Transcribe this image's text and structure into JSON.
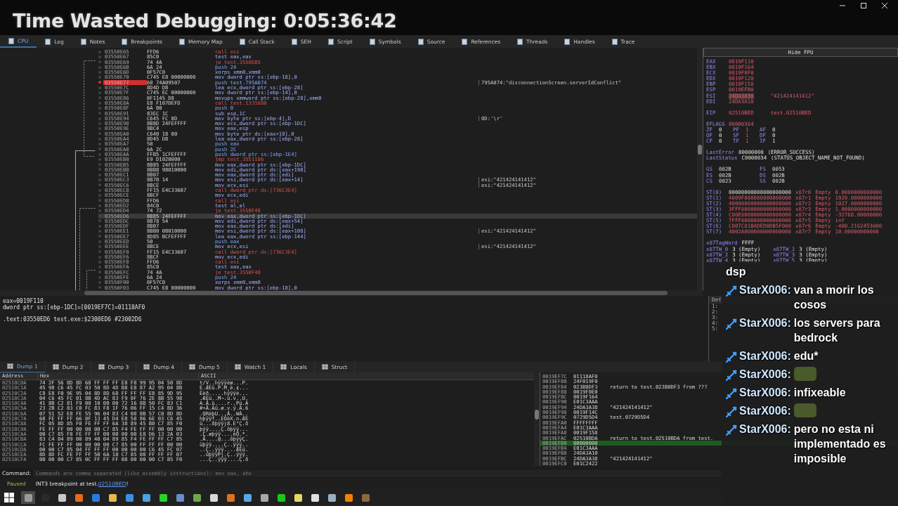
{
  "overlay_title": "Time Wasted Debugging: 0:05:36:42",
  "tabs": [
    {
      "label": "CPU",
      "selected": true
    },
    {
      "label": "Log",
      "selected": false
    },
    {
      "label": "Notes",
      "selected": false
    },
    {
      "label": "Breakpoints",
      "selected": false
    },
    {
      "label": "Memory Map",
      "selected": false
    },
    {
      "label": "Call Stack",
      "selected": false
    },
    {
      "label": "SEH",
      "selected": false
    },
    {
      "label": "Script",
      "selected": false
    },
    {
      "label": "Symbols",
      "selected": false
    },
    {
      "label": "Source",
      "selected": false
    },
    {
      "label": "References",
      "selected": false
    },
    {
      "label": "Threads",
      "selected": false
    },
    {
      "label": "Handles",
      "selected": false
    },
    {
      "label": "Trace",
      "selected": false
    }
  ],
  "disassembly": [
    {
      "address": "03550E65",
      "bytes": "FFD6",
      "instruction": "call esi",
      "kind": "call",
      "breakpoint": false,
      "selected": false
    },
    {
      "address": "03550E67",
      "bytes": "85C0",
      "instruction": "test eax,eax",
      "kind": "op",
      "breakpoint": false,
      "selected": false
    },
    {
      "address": "03550E69",
      "bytes": "74 4A",
      "instruction": "je test.3550EB5",
      "kind": "jump",
      "breakpoint": false,
      "selected": false
    },
    {
      "address": "03550E6B",
      "bytes": "6A 24",
      "instruction": "push 24",
      "kind": "push",
      "breakpoint": false,
      "selected": false
    },
    {
      "address": "03550E6D",
      "bytes": "0F57C0",
      "instruction": "xorps xmm0,xmm0",
      "kind": "op",
      "breakpoint": false,
      "selected": false
    },
    {
      "address": "03550E70",
      "bytes": "C745 E8 00000000",
      "instruction": "mov dword ptr ss:[ebp-18],0",
      "kind": "op",
      "breakpoint": false,
      "selected": false
    },
    {
      "address": "03550E77",
      "bytes": "68 74A09507",
      "instruction": "push test.795A074",
      "kind": "push",
      "breakpoint": true,
      "selected": false,
      "comment": "795A074:\"disconnectionScreen.serverIdConflict\""
    },
    {
      "address": "03550E7C",
      "bytes": "8D4D D8",
      "instruction": "lea ecx,dword ptr ss:[ebp-28]",
      "kind": "op",
      "breakpoint": false,
      "selected": false
    },
    {
      "address": "03550E7F",
      "bytes": "C745 EC 00000000",
      "instruction": "mov dword ptr ss:[ebp-14],0",
      "kind": "op",
      "breakpoint": false,
      "selected": false
    },
    {
      "address": "03550E86",
      "bytes": "0F1145 D8",
      "instruction": "movups xmmword ptr ss:[ebp-28],xmm0",
      "kind": "op",
      "breakpoint": false,
      "selected": false
    },
    {
      "address": "03550E8A",
      "bytes": "E8 F107DEFD",
      "instruction": "call test.1331680",
      "kind": "call",
      "breakpoint": false,
      "selected": false
    },
    {
      "address": "03550E8F",
      "bytes": "6A 00",
      "instruction": "push 0",
      "kind": "push",
      "breakpoint": false,
      "selected": false
    },
    {
      "address": "03550E91",
      "bytes": "83EC 1C",
      "instruction": "sub esp,1C",
      "kind": "op",
      "breakpoint": false,
      "selected": false
    },
    {
      "address": "03550E94",
      "bytes": "C645 FC 0D",
      "instruction": "mov byte ptr ss:[ebp-4],D",
      "kind": "op",
      "breakpoint": false,
      "selected": false,
      "comment": "0D:'\\r'"
    },
    {
      "address": "03550E98",
      "bytes": "8B8D 24FEFFFF",
      "instruction": "mov ecx,dword ptr ss:[ebp-1DC]",
      "kind": "op",
      "breakpoint": false,
      "selected": false
    },
    {
      "address": "03550E9E",
      "bytes": "8BC4",
      "instruction": "mov eax,esp",
      "kind": "op",
      "breakpoint": false,
      "selected": false
    },
    {
      "address": "03550EA0",
      "bytes": "C640 18 00",
      "instruction": "mov byte ptr ds:[eax+18],0",
      "kind": "op",
      "breakpoint": false,
      "selected": false
    },
    {
      "address": "03550EA4",
      "bytes": "8D45 D8",
      "instruction": "lea eax,dword ptr ss:[ebp-28]",
      "kind": "op",
      "breakpoint": false,
      "selected": false
    },
    {
      "address": "03550EA7",
      "bytes": "50",
      "instruction": "push eax",
      "kind": "push",
      "breakpoint": false,
      "selected": false
    },
    {
      "address": "03550EA8",
      "bytes": "6A 2C",
      "instruction": "push 2C",
      "kind": "push",
      "breakpoint": false,
      "selected": false
    },
    {
      "address": "03550EAA",
      "bytes": "FFB5 1CFEFFFF",
      "instruction": "push dword ptr ss:[ebp-1E4]",
      "kind": "push",
      "breakpoint": false,
      "selected": false
    },
    {
      "address": "03550EB0",
      "bytes": "E9 D1020000",
      "instruction": "jmp test.3551186",
      "kind": "jump",
      "breakpoint": false,
      "selected": false
    },
    {
      "address": "03550EB5",
      "bytes": "8B85 24FEFFFF",
      "instruction": "mov eax,dword ptr ss:[ebp-1DC]",
      "kind": "op",
      "breakpoint": false,
      "selected": false
    },
    {
      "address": "03550EBB",
      "bytes": "8BB8 98010000",
      "instruction": "mov edi,dword ptr ds:[eax+198]",
      "kind": "op",
      "breakpoint": false,
      "selected": false
    },
    {
      "address": "03550EC1",
      "bytes": "8B07",
      "instruction": "mov eax,dword ptr ds:[edi]",
      "kind": "op",
      "breakpoint": false,
      "selected": false
    },
    {
      "address": "03550EC3",
      "bytes": "8B70 14",
      "instruction": "mov esi,dword ptr ds:[eax+14]",
      "kind": "op",
      "breakpoint": false,
      "selected": false,
      "comment": "esi:\"421424141412\""
    },
    {
      "address": "03550EC6",
      "bytes": "8BCE",
      "instruction": "mov ecx,esi",
      "kind": "op",
      "breakpoint": false,
      "selected": false,
      "comment": "esi:\"421424141412\""
    },
    {
      "address": "03550EC8",
      "bytes": "FF15 E4C33607",
      "instruction": "call dword ptr ds:[736C3E4]",
      "kind": "call",
      "breakpoint": false,
      "selected": false
    },
    {
      "address": "03550ECE",
      "bytes": "8BCF",
      "instruction": "mov ecx,edi",
      "kind": "op",
      "breakpoint": false,
      "selected": false
    },
    {
      "address": "03550ED0",
      "bytes": "FFD6",
      "instruction": "call esi",
      "kind": "call",
      "breakpoint": false,
      "selected": false
    },
    {
      "address": "03550ED2",
      "bytes": "84C0",
      "instruction": "test al,al",
      "kind": "op",
      "breakpoint": false,
      "selected": false
    },
    {
      "address": "03550ED4",
      "bytes": "74 72",
      "instruction": "je test.3550F48",
      "kind": "jump",
      "breakpoint": false,
      "selected": false
    },
    {
      "address": "03550ED6",
      "bytes": "8B85 24FEFFFF",
      "instruction": "mov eax,dword ptr ss:[ebp-1DC]",
      "kind": "op",
      "breakpoint": false,
      "selected": true
    },
    {
      "address": "03550EDC",
      "bytes": "8B78 54",
      "instruction": "mov edi,dword ptr ds:[eax+54]",
      "kind": "op",
      "breakpoint": false,
      "selected": false
    },
    {
      "address": "03550EDF",
      "bytes": "8B07",
      "instruction": "mov eax,dword ptr ds:[edi]",
      "kind": "op",
      "breakpoint": false,
      "selected": false
    },
    {
      "address": "03550EE1",
      "bytes": "8BB0 08010000",
      "instruction": "mov esi,dword ptr ds:[eax+108]",
      "kind": "op",
      "breakpoint": false,
      "selected": false,
      "comment": "esi:\"421424141412\""
    },
    {
      "address": "03550EE7",
      "bytes": "8D85 BCFEFFFF",
      "instruction": "lea eax,dword ptr ss:[ebp-144]",
      "kind": "op",
      "breakpoint": false,
      "selected": false
    },
    {
      "address": "03550EED",
      "bytes": "50",
      "instruction": "push eax",
      "kind": "push",
      "breakpoint": false,
      "selected": false
    },
    {
      "address": "03550EEE",
      "bytes": "8BCE",
      "instruction": "mov ecx,esi",
      "kind": "op",
      "breakpoint": false,
      "selected": false,
      "comment": "esi:\"421424141412\""
    },
    {
      "address": "03550EF0",
      "bytes": "FF15 E4C33607",
      "instruction": "call dword ptr ds:[736C3E4]",
      "kind": "call",
      "breakpoint": false,
      "selected": false
    },
    {
      "address": "03550EF6",
      "bytes": "8BCF",
      "instruction": "mov ecx,edi",
      "kind": "op",
      "breakpoint": false,
      "selected": false
    },
    {
      "address": "03550EF8",
      "bytes": "FFD6",
      "instruction": "call esi",
      "kind": "call",
      "breakpoint": false,
      "selected": false
    },
    {
      "address": "03550EFA",
      "bytes": "85C0",
      "instruction": "test eax,eax",
      "kind": "op",
      "breakpoint": false,
      "selected": false
    },
    {
      "address": "03550EFC",
      "bytes": "74 4A",
      "instruction": "je test.3550F48",
      "kind": "jump",
      "breakpoint": false,
      "selected": false
    },
    {
      "address": "03550EFE",
      "bytes": "6A 24",
      "instruction": "push 24",
      "kind": "push",
      "breakpoint": false,
      "selected": false
    },
    {
      "address": "03550F00",
      "bytes": "0F57C0",
      "instruction": "xorps xmm0,xmm0",
      "kind": "op",
      "breakpoint": false,
      "selected": false
    },
    {
      "address": "03550F03",
      "bytes": "C745 E8 00000000",
      "instruction": "mov dword ptr ss:[ebp-18],0",
      "kind": "op",
      "breakpoint": false,
      "selected": false
    }
  ],
  "registers": {
    "button": "Hide FPU",
    "general": [
      {
        "name": "EAX",
        "value": "0019F110",
        "selected": false
      },
      {
        "name": "EBX",
        "value": "0019F164",
        "selected": false
      },
      {
        "name": "ECX",
        "value": "0019F0F0",
        "selected": false
      },
      {
        "name": "EDX",
        "value": "0019F120",
        "selected": false
      },
      {
        "name": "EBP",
        "value": "0019F158",
        "selected": false
      },
      {
        "name": "ESP",
        "value": "0019EFB0",
        "selected": false
      },
      {
        "name": "ESI",
        "value": "24DA3A38",
        "selected": true,
        "comment": "\"421424141412\""
      },
      {
        "name": "EDI",
        "value": "24DA3A10",
        "selected": false
      }
    ],
    "eip": {
      "name": "EIP",
      "value": "02510BED",
      "comment": "test.02510BED"
    },
    "eflags": {
      "name": "EFLAGS",
      "value": "00000384"
    },
    "flags": [
      [
        {
          "name": "ZF",
          "value": "0",
          "changed": false
        },
        {
          "name": "PF",
          "value": "1",
          "changed": true
        },
        {
          "name": "AF",
          "value": "0",
          "changed": false
        }
      ],
      [
        {
          "name": "OF",
          "value": "0",
          "changed": false
        },
        {
          "name": "SF",
          "value": "1",
          "changed": true
        },
        {
          "name": "DF",
          "value": "0",
          "changed": false
        }
      ],
      [
        {
          "name": "CF",
          "value": "0",
          "changed": false
        },
        {
          "name": "TF",
          "value": "1",
          "changed": true
        },
        {
          "name": "IF",
          "value": "1",
          "changed": false
        }
      ]
    ],
    "last": [
      {
        "name": "LastError",
        "value": "00000000",
        "comment": "(ERROR_SUCCESS)"
      },
      {
        "name": "LastStatus",
        "value": "C0000034",
        "comment": "(STATUS_OBJECT_NAME_NOT_FOUND)"
      }
    ],
    "segments": [
      [
        {
          "name": "GS",
          "value": "002B"
        },
        {
          "name": "FS",
          "value": "0053"
        }
      ],
      [
        {
          "name": "ES",
          "value": "002B"
        },
        {
          "name": "DS",
          "value": "002B"
        }
      ],
      [
        {
          "name": "CS",
          "value": "0023"
        },
        {
          "name": "SS",
          "value": "002B"
        }
      ]
    ],
    "fpu": [
      {
        "name": "ST(0)",
        "value": "00000000000000000000",
        "tag": "x87r0",
        "status": "Empty",
        "number": "0.0000000000000",
        "changed": false
      },
      {
        "name": "ST(1)",
        "value": "4009F000000000000000",
        "tag": "x87r1",
        "status": "Empty",
        "number": "1920.0000000000",
        "changed": true
      },
      {
        "name": "ST(2)",
        "value": "40098060000000000000",
        "tag": "x87r2",
        "status": "Empty",
        "number": "1027.0000000000",
        "changed": true
      },
      {
        "name": "ST(3)",
        "value": "3FFF8000000000000000",
        "tag": "x87r3",
        "status": "Empty",
        "number": "1.0000000000000",
        "changed": true
      },
      {
        "name": "ST(4)",
        "value": "C00E8000000000000000",
        "tag": "x87r4",
        "status": "Empty",
        "number": "-32768.00000000",
        "changed": true
      },
      {
        "name": "ST(5)",
        "value": "7FFF8000000000000000",
        "tag": "x87r5",
        "status": "Empty",
        "number": "inf",
        "changed": true
      },
      {
        "name": "ST(6)",
        "value": "C007C81BADED0DB5F000",
        "tag": "x87r6",
        "status": "Empty",
        "number": "-400.2162453000",
        "changed": true
      },
      {
        "name": "ST(7)",
        "value": "4002A000000000000000",
        "tag": "x87r7",
        "status": "Empty",
        "number": "10.00000000000",
        "changed": true
      }
    ],
    "tagword": {
      "name": "x87TagWord",
      "value": "FFFF"
    },
    "tagwords": [
      [
        {
          "name": "x87TW_0",
          "value": "3 (Empty)"
        },
        {
          "name": "x87TW_1",
          "value": "3 (Empty)"
        }
      ],
      [
        {
          "name": "x87TW_2",
          "value": "3 (Empty)"
        },
        {
          "name": "x87TW_3",
          "value": "3 (Empty)"
        }
      ],
      [
        {
          "name": "x87TW_4",
          "value": "3 (Empty)"
        },
        {
          "name": "x87TW_5",
          "value": "3 (Empty)"
        }
      ]
    ]
  },
  "info": [
    "eax=0019F110",
    "dword ptr ss:[ebp-1DC]=[0019EF7C]=01118AF0",
    ".text:03550ED6 test.exe:$2300ED6 #23002D6"
  ],
  "arguments": {
    "header": "Def",
    "rows": [
      "1:",
      "2:",
      "3:",
      "4:",
      "5:"
    ]
  },
  "dump_tabs": [
    {
      "label": "Dump 1",
      "selected": true
    },
    {
      "label": "Dump 2",
      "selected": false
    },
    {
      "label": "Dump 3",
      "selected": false
    },
    {
      "label": "Dump 4",
      "selected": false
    },
    {
      "label": "Dump 5",
      "selected": false
    },
    {
      "label": "Watch 1",
      "selected": false
    },
    {
      "label": "Locals",
      "selected": false
    },
    {
      "label": "Struct",
      "selected": false
    }
  ],
  "dump": {
    "columns": [
      "Address",
      "Hex",
      "ASCII"
    ],
    "rows": [
      {
        "address": "02510C0A",
        "hex": "74 2F 56 8D 8D 68 FF FF FF E8 F8 99 95 04 50 8D",
        "ascii": "t/V..hÿÿÿèø...P."
      },
      {
        "address": "02510C1A",
        "hex": "45 98 C6 45 FC 03 50 8D 4D B8 E8 87 A2 95 04 8B",
        "ascii": "E.ÆEü.P.M¸è.¢..."
      },
      {
        "address": "02510C2A",
        "hex": "C8 E8 F0 9E 95 04 8D 8D 68 FF FF FF E8 85 9D 95",
        "ascii": "Èèð.....hÿÿÿè..."
      },
      {
        "address": "02510C3A",
        "hex": "04 C6 45 FC 01 8B 4D AC 83 F9 0F 76 2E 8B 55 98",
        "ascii": ".ÆEü..M¬.ù.v..U."
      },
      {
        "address": "02510C4A",
        "hex": "41 8B C2 81 F9 00 10 00 00 72 16 8B 50 FC 83 C1",
        "ascii": "A.Â.ù....r..Pü.Á"
      },
      {
        "address": "02510C5A",
        "hex": "23 2B C2 83 C0 FC 83 F8 1F 76 06 FF 15 C4 8D 36",
        "ascii": "#+Â.Àü.ø.v.ÿ.Ä.6"
      },
      {
        "address": "02510C6A",
        "hex": "07 51 52 E8 FE 55 96 04 83 C4 08 8B 57 C0 8D 8D",
        "ascii": ".QRèþU...Ä..WÀ.."
      },
      {
        "address": "02510C7A",
        "hex": "68 FE FF FF 66 0F 13 45 D4 E8 58 86 6E 03 C6 45",
        "ascii": "hþÿÿf..EÔèX.n.ÆE"
      },
      {
        "address": "02510C8A",
        "hex": "FC 05 8D 85 F0 FE FF FF 6A 38 89 45 B0 C7 85 F0",
        "ascii": "ü...ðþÿÿj8.E°Ç.ð"
      },
      {
        "address": "02510C9A",
        "hex": "FE FF FF 00 00 00 00 C7 85 F4 FE FF FF 00 00 00",
        "ascii": "þÿÿ....Ç.ôþÿÿ..."
      },
      {
        "address": "02510CAA",
        "hex": "00 C7 85 F8 FE FF FF 00 00 00 00 E8 D6 13 2A 03",
        "ascii": ".Ç.øþÿÿ....èÖ.*."
      },
      {
        "address": "02510CBA",
        "hex": "83 C4 04 89 00 89 40 04 89 85 F4 FE FF FF C7 85",
        "ascii": ".Ä....@...ôþÿÿÇ."
      },
      {
        "address": "02510CCA",
        "hex": "FC FE FF FF 00 00 00 00 C7 85 00 FF FF FF 00 00",
        "ascii": "üþÿÿ....Ç..ÿÿÿ.."
      },
      {
        "address": "02510CDA",
        "hex": "00 00 C7 85 04 FF FF FF 00 00 00 00 C6 45 FC 07",
        "ascii": "..Ç..ÿÿÿ....ÆEü."
      },
      {
        "address": "02510CEA",
        "hex": "8D 8D FC FE FF FF 50 6A 10 C7 85 08 FF FF FF 07",
        "ascii": "..üþÿÿPj.Ç..ÿÿÿ."
      },
      {
        "address": "02510CFA",
        "hex": "00 00 00 C7 85 0C FF FF FF 08 00 00 00 C7 85 F0",
        "ascii": "...Ç..ÿÿÿ....Ç.ð"
      }
    ]
  },
  "stack": [
    {
      "address": "0019EF7C",
      "value": "01118AF0",
      "selected": false
    },
    {
      "address": "0019EF80",
      "value": "24F019F0",
      "selected": false
    },
    {
      "address": "0019EF84",
      "value": "023B0DF3",
      "selected": false,
      "comment": "return to test.023B0DF3 from ???"
    },
    {
      "address": "0019EF88",
      "value": "0019F0E0",
      "selected": false
    },
    {
      "address": "0019EF8C",
      "value": "0019F164",
      "selected": false
    },
    {
      "address": "0019EF90",
      "value": "E01C3AAA",
      "selected": false
    },
    {
      "address": "0019EF94",
      "value": "24DA3A38",
      "selected": false,
      "comment": "\"421424141412\""
    },
    {
      "address": "0019EF98",
      "value": "0019F14C",
      "selected": false
    },
    {
      "address": "0019EF9C",
      "value": "0729D5D4",
      "selected": false,
      "comment": "test.0729D5D4"
    },
    {
      "address": "0019EFA0",
      "value": "FFFFFFFF",
      "selected": false
    },
    {
      "address": "0019EFA4",
      "value": "E01C3AAA",
      "selected": false
    },
    {
      "address": "0019EFA8",
      "value": "0019F158",
      "selected": false
    },
    {
      "address": "0019EFAC",
      "value": "02510BDA",
      "selected": false,
      "comment": "return to test.02510BDA from test."
    },
    {
      "address": "0019EFB0",
      "value": "00000000",
      "selected": true
    },
    {
      "address": "0019EFB4",
      "value": "E01C3AAA",
      "selected": false
    },
    {
      "address": "0019EFB8",
      "value": "24DA3A10",
      "selected": false
    },
    {
      "address": "0019EFBC",
      "value": "24DA3A38",
      "selected": false,
      "comment": "\"421424141412\""
    },
    {
      "address": "0019EFC0",
      "value": "E01C2422",
      "selected": false
    }
  ],
  "command": {
    "label": "Command:",
    "placeholder": "Commands are comma separated (like assembly instructions): mov eax, ebx"
  },
  "status": {
    "state": "Paused",
    "message": "INT3 breakpoint at test.",
    "link": "02510BED",
    "suffix": "!"
  },
  "taskbar": [
    {
      "color": "#9a9a9a",
      "selected": true
    },
    {
      "color": "#2a2a2a",
      "selected": false
    },
    {
      "color": "#c8c8c8",
      "selected": false
    },
    {
      "color": "#e66a1e",
      "selected": false
    },
    {
      "color": "#2a7ae2",
      "selected": false
    },
    {
      "color": "#e8b84a",
      "selected": false
    },
    {
      "color": "#3c8ee0",
      "selected": false
    },
    {
      "color": "#4aa0e0",
      "selected": false
    },
    {
      "color": "#2bd12b",
      "selected": false
    },
    {
      "color": "#6a8cc8",
      "selected": false
    },
    {
      "color": "#6aa84f",
      "selected": false
    },
    {
      "color": "#d8d8d8",
      "selected": false
    },
    {
      "color": "#e07020",
      "selected": false
    },
    {
      "color": "#58a8e8",
      "selected": false
    },
    {
      "color": "#a8a8a8",
      "selected": false
    },
    {
      "color": "#18c818",
      "selected": false
    },
    {
      "color": "#e8d860",
      "selected": false
    },
    {
      "color": "#e0e0e0",
      "selected": false
    },
    {
      "color": "#9ab0c0",
      "selected": false
    },
    {
      "color": "#f08000",
      "selected": false
    },
    {
      "color": "#8a6a3a",
      "selected": false
    }
  ],
  "chat": [
    {
      "kind": "text",
      "text": "dsp"
    },
    {
      "kind": "text",
      "user": "StarX006:",
      "text": "van a morir los cosos"
    },
    {
      "kind": "text",
      "user": "StarX006:",
      "text": "los servers para bedrock"
    },
    {
      "kind": "text",
      "user": "StarX006:",
      "text": "edu*"
    },
    {
      "kind": "sticker",
      "user": "StarX006:"
    },
    {
      "kind": "text",
      "user": "StarX006:",
      "text": "infixeable"
    },
    {
      "kind": "sticker",
      "user": "StarX006:"
    },
    {
      "kind": "text",
      "user": "StarX006:",
      "text": "pero no esta ni implementado es imposible"
    }
  ]
}
